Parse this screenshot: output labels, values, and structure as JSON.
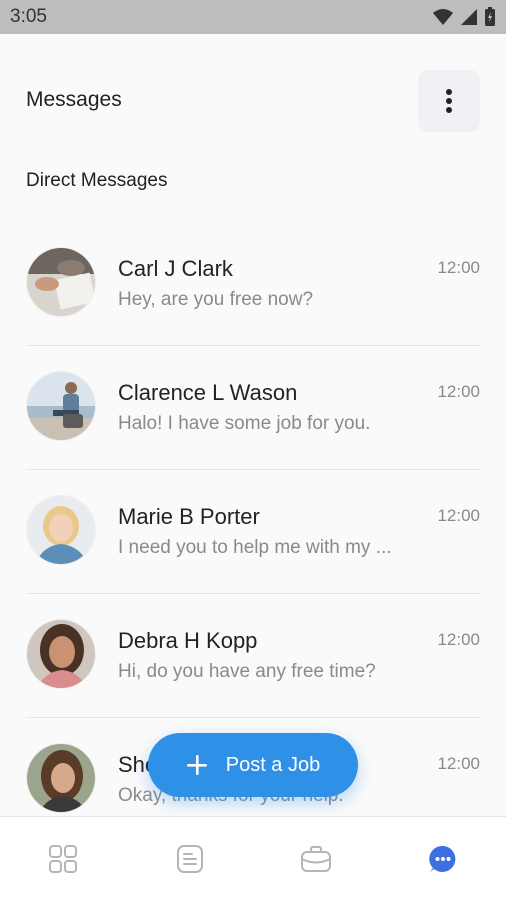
{
  "status_bar": {
    "time": "3:05"
  },
  "header": {
    "title": "Messages"
  },
  "section": {
    "title": "Direct Messages"
  },
  "conversations": [
    {
      "name": "Carl J Clark",
      "preview": "Hey, are you free now?",
      "time": "12:00"
    },
    {
      "name": "Clarence L Wason",
      "preview": "Halo! I have some job for you.",
      "time": "12:00"
    },
    {
      "name": "Marie B Porter",
      "preview": "I need you to help me with my ...",
      "time": "12:00"
    },
    {
      "name": "Debra H Kopp",
      "preview": "Hi, do you have any free time?",
      "time": "12:00"
    },
    {
      "name": "She",
      "preview": "Okay, thanks for your help.",
      "time": "12:00"
    }
  ],
  "fab": {
    "label": "Post a Job"
  },
  "bottom_nav": {
    "items": [
      {
        "icon": "grid-icon",
        "active": false
      },
      {
        "icon": "document-icon",
        "active": false
      },
      {
        "icon": "briefcase-icon",
        "active": false
      },
      {
        "icon": "chat-icon",
        "active": true
      }
    ],
    "active_color": "#3d6fe0",
    "inactive_color": "#b5b5b5"
  },
  "colors": {
    "accent": "#2f90e8",
    "background": "#fafafa"
  }
}
